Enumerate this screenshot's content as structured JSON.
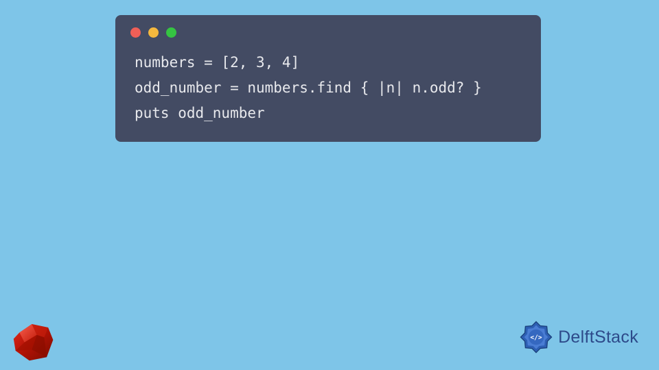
{
  "code": {
    "lines": [
      "numbers = [2, 3, 4]",
      "odd_number = numbers.find { |n| n.odd? }",
      "puts odd_number"
    ]
  },
  "brand": {
    "name": "DelftStack"
  },
  "colors": {
    "background": "#7ec5e8",
    "window": "#434b63",
    "text": "#e8e9ed",
    "brand": "#2d4a8a",
    "ruby": "#b11205"
  }
}
